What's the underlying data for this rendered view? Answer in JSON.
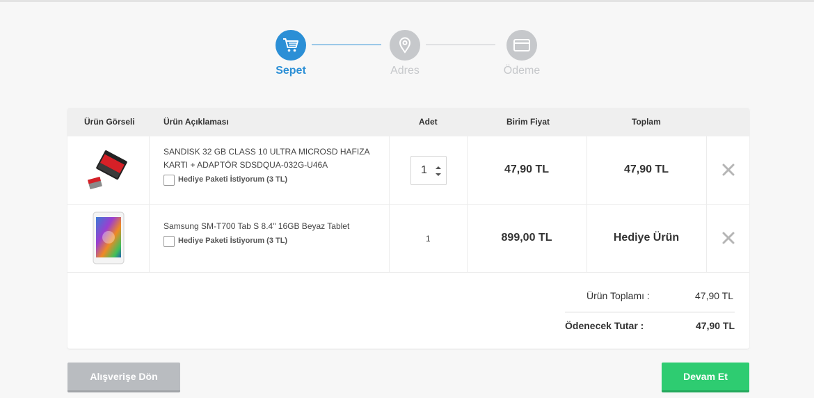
{
  "colors": {
    "accent": "#2b8fd6",
    "inactive": "#c6c8cb",
    "success": "#2ecc71",
    "neutral_button": "#b9bcc0"
  },
  "steps": [
    {
      "label": "Sepet",
      "icon": "cart-icon",
      "active": true
    },
    {
      "label": "Adres",
      "icon": "map-pin-icon",
      "active": false
    },
    {
      "label": "Ödeme",
      "icon": "credit-card-icon",
      "active": false
    }
  ],
  "table": {
    "headers": {
      "image": "Ürün Görseli",
      "description": "Ürün Açıklaması",
      "quantity": "Adet",
      "unit_price": "Birim Fiyat",
      "total": "Toplam"
    },
    "rows": [
      {
        "image_icon": "microsd-card-image",
        "description_line1": "SANDISK 32 GB CLASS 10 ULTRA MICROSD HAFIZA",
        "description_line2": "KARTI + ADAPTÖR SDSDQUA-032G-U46A",
        "gift_label": "Hediye Paketi İstiyorum (3 TL)",
        "quantity": "1",
        "unit_price": "47,90 TL",
        "total": "47,90 TL"
      },
      {
        "image_icon": "tablet-image",
        "description_line1": "Samsung SM-T700 Tab S 8.4\" 16GB Beyaz Tablet",
        "gift_label": "Hediye Paketi İstiyorum (3 TL)",
        "quantity": "1",
        "unit_price": "899,00 TL",
        "total": "Hediye Ürün"
      }
    ]
  },
  "summary": {
    "subtotal_label": "Ürün Toplamı :",
    "subtotal_value": "47,90 TL",
    "payable_label": "Ödenecek Tutar :",
    "payable_value": "47,90 TL"
  },
  "buttons": {
    "back": "Alışverişe Dön",
    "next": "Devam Et"
  }
}
